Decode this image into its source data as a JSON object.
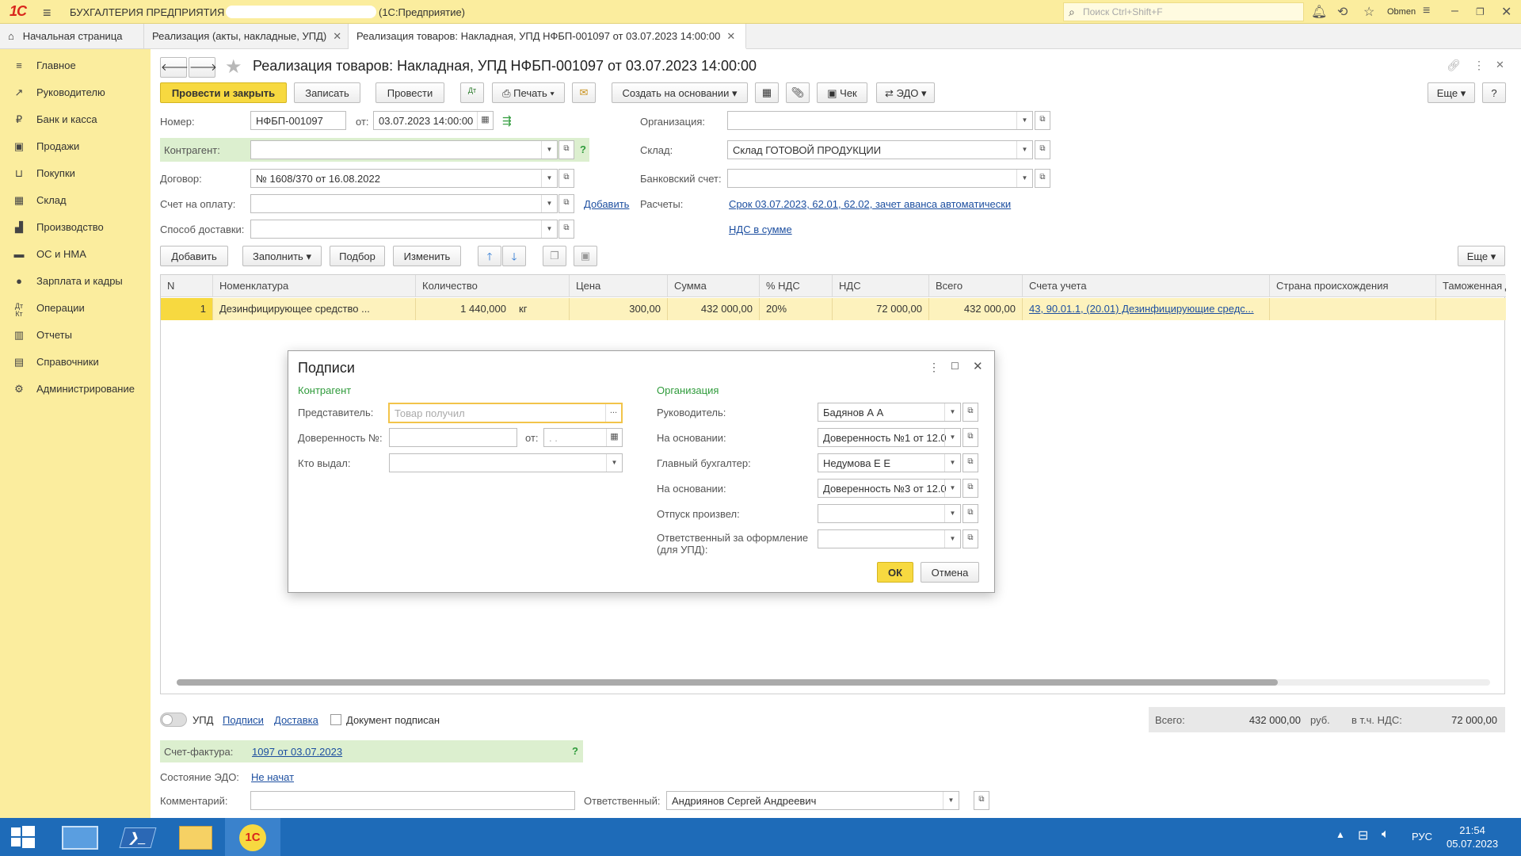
{
  "titlebar": {
    "logo": "1С",
    "app_name": "БУХГАЛТЕРИЯ ПРЕДПРИЯТИЯ",
    "mode": "(1С:Предприятие)",
    "search_placeholder": "Поиск Ctrl+Shift+F",
    "user": "Obmen"
  },
  "tabs": [
    {
      "label": "Начальная страница"
    },
    {
      "label": "Реализация (акты, накладные, УПД)"
    },
    {
      "label": "Реализация товаров: Накладная, УПД НФБП-001097 от 03.07.2023 14:00:00"
    }
  ],
  "sidebar": {
    "items": [
      {
        "label": "Главное"
      },
      {
        "label": "Руководителю"
      },
      {
        "label": "Банк и касса"
      },
      {
        "label": "Продажи"
      },
      {
        "label": "Покупки"
      },
      {
        "label": "Склад"
      },
      {
        "label": "Производство"
      },
      {
        "label": "ОС и НМА"
      },
      {
        "label": "Зарплата и кадры"
      },
      {
        "label": "Операции"
      },
      {
        "label": "Отчеты"
      },
      {
        "label": "Справочники"
      },
      {
        "label": "Администрирование"
      }
    ]
  },
  "doc": {
    "title": "Реализация товаров: Накладная, УПД НФБП-001097 от 03.07.2023 14:00:00",
    "toolbar": {
      "post_close": "Провести и закрыть",
      "save": "Записать",
      "post": "Провести",
      "print": "Печать",
      "create_based": "Создать на основании",
      "check": "Чек",
      "edo": "ЭДО",
      "more": "Еще",
      "help": "?"
    },
    "fields": {
      "number_label": "Номер:",
      "number_value": "НФБП-001097",
      "from_label": "от:",
      "date_value": "03.07.2023 14:00:00",
      "counterparty_label": "Контрагент:",
      "contract_label": "Договор:",
      "contract_value": "№  1608/370 от 16.08.2022",
      "invoice_label": "Счет на оплату:",
      "add_link": "Добавить",
      "delivery_label": "Способ доставки:",
      "org_label": "Организация:",
      "warehouse_label": "Склад:",
      "warehouse_value": "Склад ГОТОВОЙ ПРОДУКЦИИ",
      "bank_label": "Банковский счет:",
      "settlements_label": "Расчеты:",
      "settlements_link": "Срок 03.07.2023, 62.01, 62.02, зачет аванса автоматически",
      "vat_link": "НДС в сумме"
    },
    "table_toolbar": {
      "add": "Добавить",
      "fill": "Заполнить",
      "pick": "Подбор",
      "change": "Изменить",
      "more": "Еще"
    },
    "table": {
      "headers": [
        "N",
        "Номенклатура",
        "Количество",
        "Цена",
        "Сумма",
        "% НДС",
        "НДС",
        "Всего",
        "Счета учета",
        "Страна происхождения",
        "Таможенная д"
      ],
      "rows": [
        {
          "n": "1",
          "name": "Дезинфицирующее средство ...",
          "qty": "1 440,000",
          "unit": "кг",
          "price": "300,00",
          "sum": "432 000,00",
          "vat_rate": "20%",
          "vat": "72 000,00",
          "total": "432 000,00",
          "accounts": "43, 90.01.1, (20.01) Дезинфицирующие средс..."
        }
      ]
    },
    "bottom": {
      "upd_label": "УПД",
      "signatures_link": "Подписи",
      "delivery_link": "Доставка",
      "signed_label": "Документ подписан",
      "total_label": "Всего:",
      "total_value": "432 000,00",
      "currency": "руб.",
      "vat_incl_label": "в т.ч. НДС:",
      "vat_incl_value": "72 000,00",
      "invoice_label": "Счет-фактура:",
      "invoice_link": "1097 от 03.07.2023",
      "invoice_help": "?",
      "edo_state_label": "Состояние ЭДО:",
      "edo_state_link": "Не начат",
      "comment_label": "Комментарий:",
      "responsible_label": "Ответственный:",
      "responsible_value": "Андриянов Сергей Андреевич"
    }
  },
  "modal": {
    "title": "Подписи",
    "left_section": "Контрагент",
    "right_section": "Организация",
    "representative_label": "Представитель:",
    "representative_placeholder": "Товар получил",
    "poa_label": "Доверенность №:",
    "poa_from_label": "от:",
    "poa_date_placeholder": " .  .",
    "issued_by_label": "Кто выдал:",
    "director_label": "Руководитель:",
    "director_value": "Бадянов А         А",
    "basis1_label": "На основании:",
    "basis1_value": "Доверенность №1 от 12.0",
    "accountant_label": "Главный бухгалтер:",
    "accountant_value": "Недумова Е         Е",
    "basis2_label": "На основании:",
    "basis2_value": "Доверенность №3 от 12.0",
    "released_label": "Отпуск произвел:",
    "responsible_label": "Ответственный за оформление",
    "responsible_label2": "(для УПД):",
    "ok": "ОК",
    "cancel": "Отмена"
  },
  "taskbar": {
    "lang": "РУС",
    "time": "21:54",
    "date": "05.07.2023"
  },
  "colors": {
    "accent_yellow": "#fbed9e",
    "button_yellow": "#f7d940",
    "link_blue": "#1d4fa0",
    "section_green": "#2f9b3b",
    "taskbar_blue": "#1e6bb8"
  }
}
